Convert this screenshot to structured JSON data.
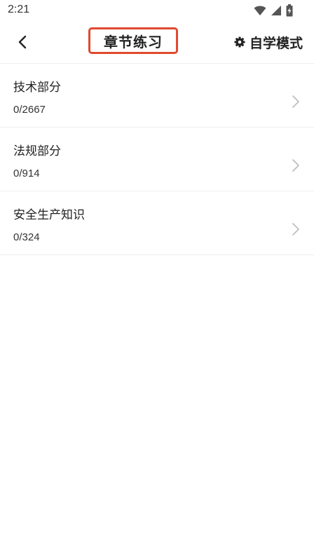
{
  "status_bar": {
    "time": "2:21",
    "icons": [
      "wifi-icon",
      "signal-icon",
      "battery-icon"
    ]
  },
  "header": {
    "back_icon": "chevron-left-icon",
    "title": "章节练习",
    "mode_icon": "gear-icon",
    "mode_label": "自学模式"
  },
  "chapters": [
    {
      "title": "技术部分",
      "progress": "0/2667"
    },
    {
      "title": "法规部分",
      "progress": "0/914"
    },
    {
      "title": "安全生产知识",
      "progress": "0/324"
    }
  ],
  "colors": {
    "highlight_border": "#e0492f",
    "divider": "#eeeeee",
    "chevron": "#bbbbbb",
    "text": "#222222"
  }
}
